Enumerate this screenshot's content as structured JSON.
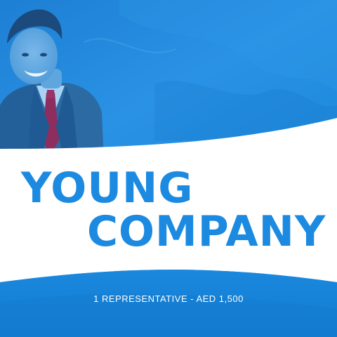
{
  "banner": {
    "title_line_1": "YOUNG",
    "title_line_2": "COMPANY",
    "subtitle": "1 REPRESENTATIVE - AED 1,500"
  },
  "colors": {
    "background_blue": "#1a88de",
    "title_blue": "#1b8ae0",
    "white_band": "#ffffff",
    "text_light": "#ffffff"
  }
}
